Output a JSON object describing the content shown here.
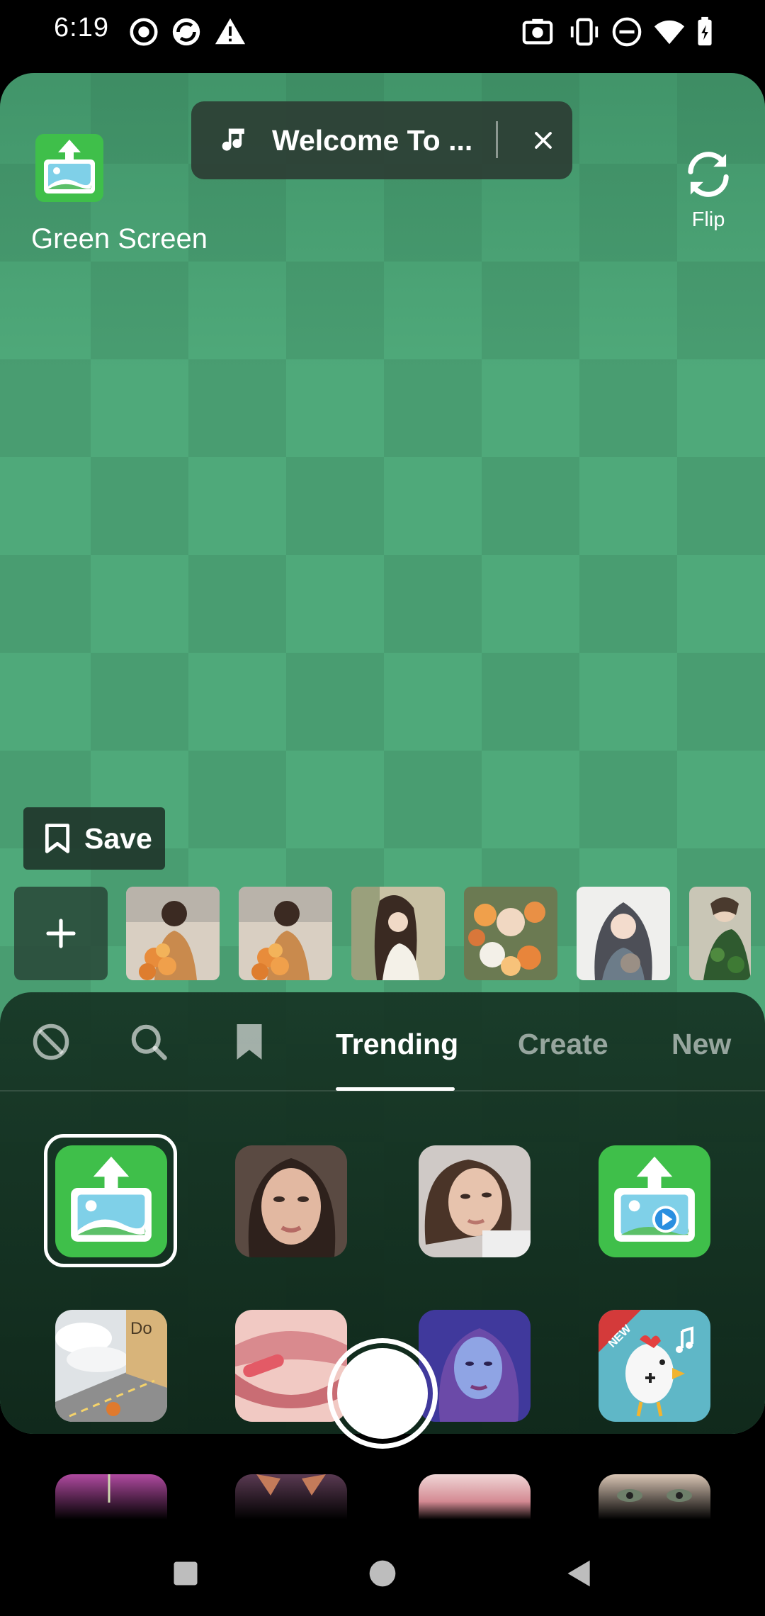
{
  "status_bar": {
    "time": "6:19",
    "left_icons": [
      "record-icon",
      "sync-icon",
      "warning-icon"
    ],
    "right_icons": [
      "screenshot-icon",
      "vibrate-icon",
      "dnd-icon",
      "wifi-icon",
      "battery-icon"
    ]
  },
  "effect": {
    "name": "Green Screen",
    "logo_icon": "upload-image-icon"
  },
  "music": {
    "title": "Welcome To ...",
    "note_icon": "music-note-icon",
    "close_icon": "close-icon"
  },
  "flip": {
    "label": "Flip",
    "icon": "flip-camera-icon"
  },
  "save": {
    "label": "Save",
    "icon": "bookmark-icon"
  },
  "backgrounds": {
    "add_icon": "plus-icon",
    "thumbnails": [
      "girl-with-flowers-1",
      "girl-with-flowers-2",
      "girl-reading",
      "girl-in-flowers",
      "girl-with-cat",
      "girl-with-plants"
    ]
  },
  "tabs": {
    "icons": [
      "none-icon",
      "search-icon",
      "bookmark-icon"
    ],
    "labels": [
      "Trending",
      "Create",
      "New"
    ],
    "active": "Trending"
  },
  "effects_grid": [
    {
      "name": "green-screen-image",
      "selected": true
    },
    {
      "name": "face-portrait-1"
    },
    {
      "name": "face-portrait-2"
    },
    {
      "name": "green-screen-video"
    },
    {
      "name": "road-game",
      "badge": "Do"
    },
    {
      "name": "lips"
    },
    {
      "name": "neon-portrait"
    },
    {
      "name": "chicken-music",
      "badge": "NEW"
    }
  ],
  "colors": {
    "green_screen": "#4fa97a",
    "panel": "#16341f",
    "effect_green": "#3fbf4a"
  },
  "nav": [
    "recents-button",
    "home-button",
    "back-button"
  ]
}
